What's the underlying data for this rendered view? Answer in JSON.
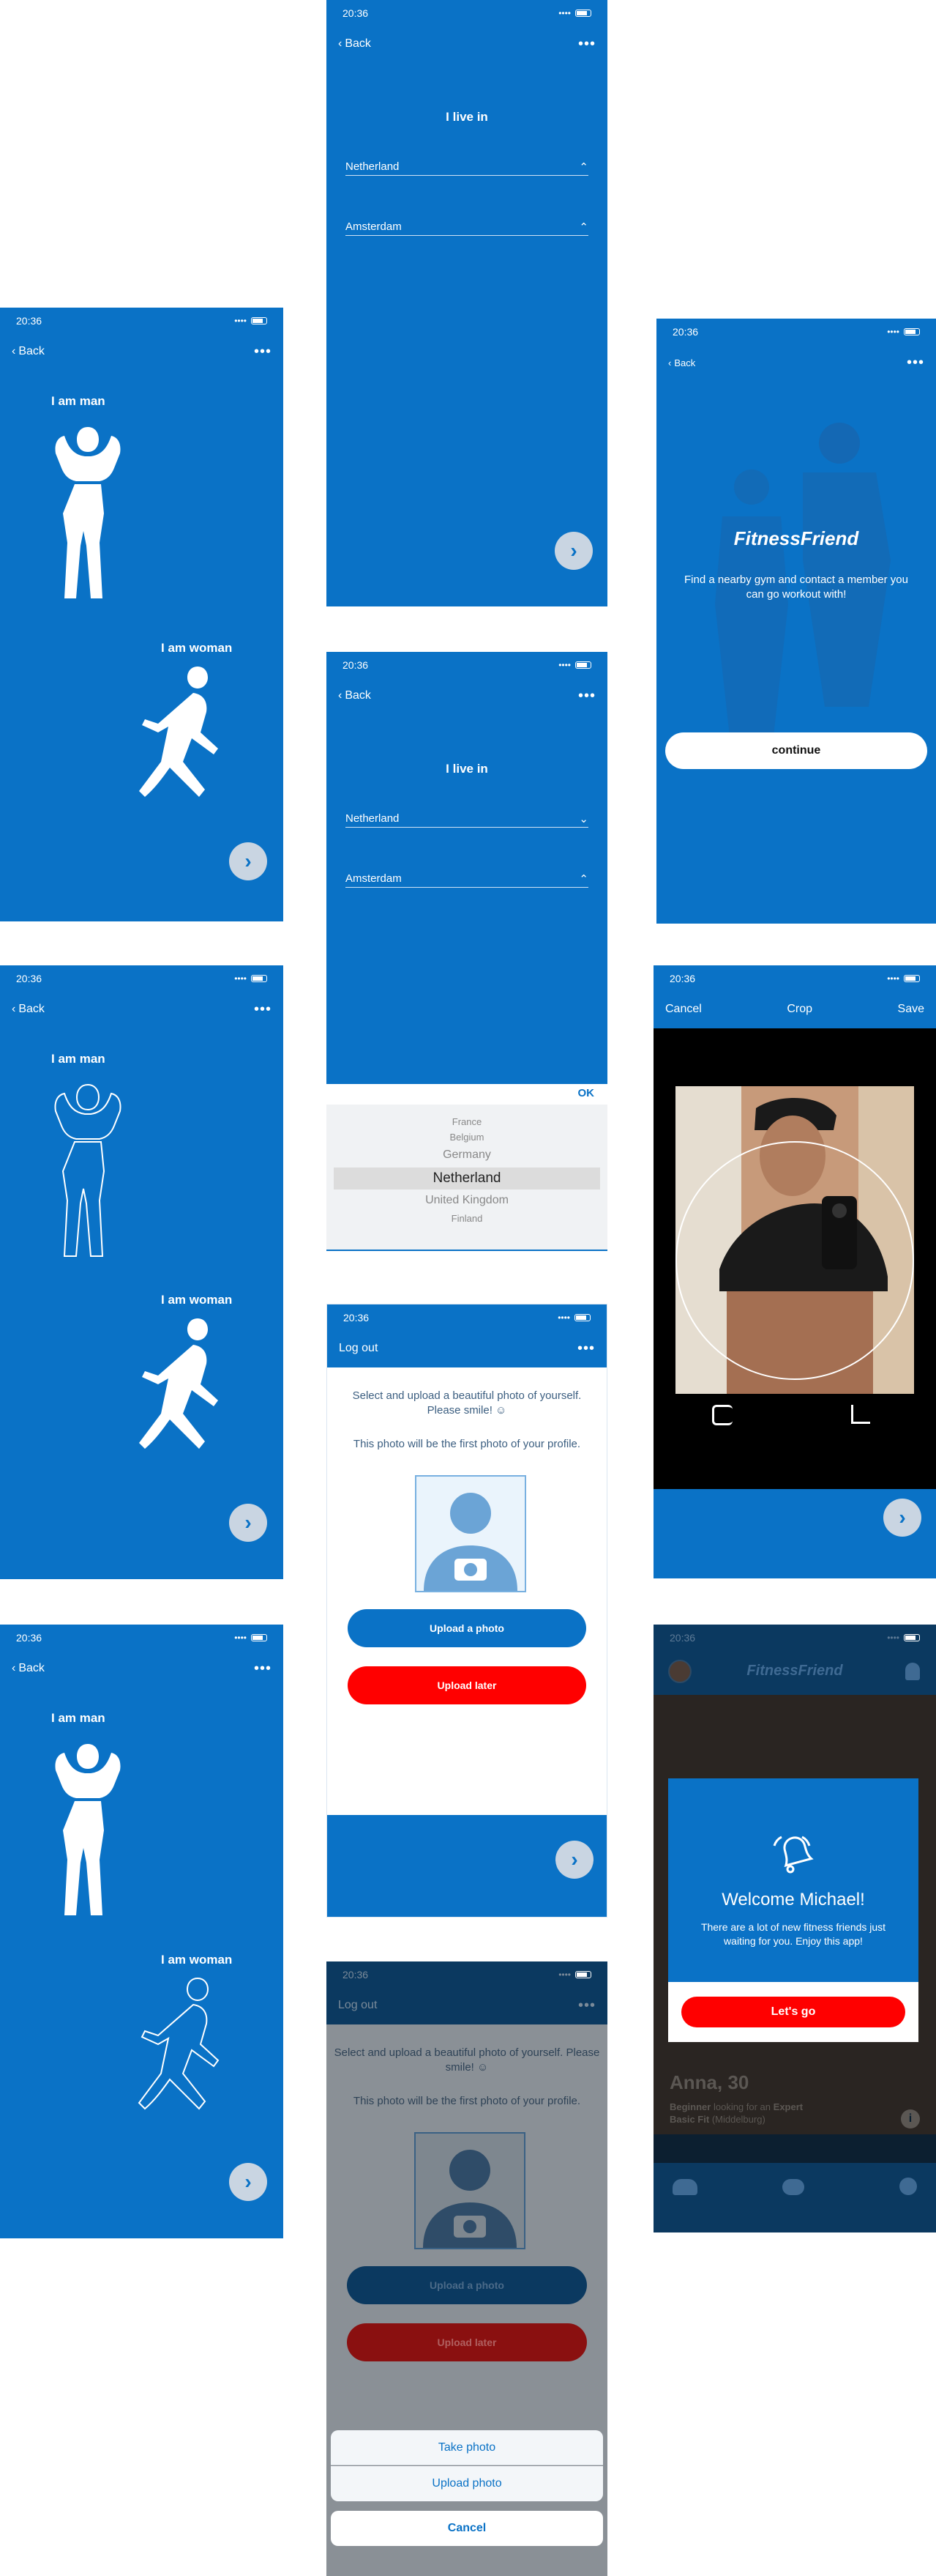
{
  "status": {
    "time": "20:36",
    "signal": "••••",
    "wifi": "◠"
  },
  "nav": {
    "back": "Back",
    "more": "•••",
    "logout": "Log out"
  },
  "gender": {
    "man": "I am man",
    "woman": "I am woman"
  },
  "location": {
    "title": "I live in",
    "country": "Netherland",
    "city": "Amsterdam"
  },
  "picker": {
    "ok": "OK",
    "options": [
      "France",
      "Belgium",
      "Germany",
      "Netherland",
      "United Kingdom",
      "Finland"
    ]
  },
  "intro": {
    "brand": "FitnessFriend",
    "tagline": "Find a nearby gym and contact a member you can go workout with!",
    "continue": "continue"
  },
  "crop": {
    "cancel": "Cancel",
    "title": "Crop",
    "save": "Save"
  },
  "upload": {
    "prompt": "Select and upload a beautiful photo of yourself. Please smile! ☺",
    "note": "This photo will be the first photo of your profile.",
    "upload_btn": "Upload a photo",
    "later_btn": "Upload later"
  },
  "sheet": {
    "take": "Take photo",
    "upload": "Upload photo",
    "cancel": "Cancel"
  },
  "welcome": {
    "brand": "FitnessFriend",
    "title": "Welcome Michael!",
    "text": "There are a lot of new fitness friends just waiting for you. Enjoy this app!",
    "button": "Let's go",
    "card_name": "Anna, 30",
    "card_level": "Beginner",
    "card_looking": "looking for an",
    "card_level2": "Expert",
    "card_gym": "Basic Fit",
    "card_city": "(Middelburg)"
  },
  "colors": {
    "brand": "#0a72c6",
    "danger": "#ff0000",
    "overlay": "#0b3960"
  }
}
